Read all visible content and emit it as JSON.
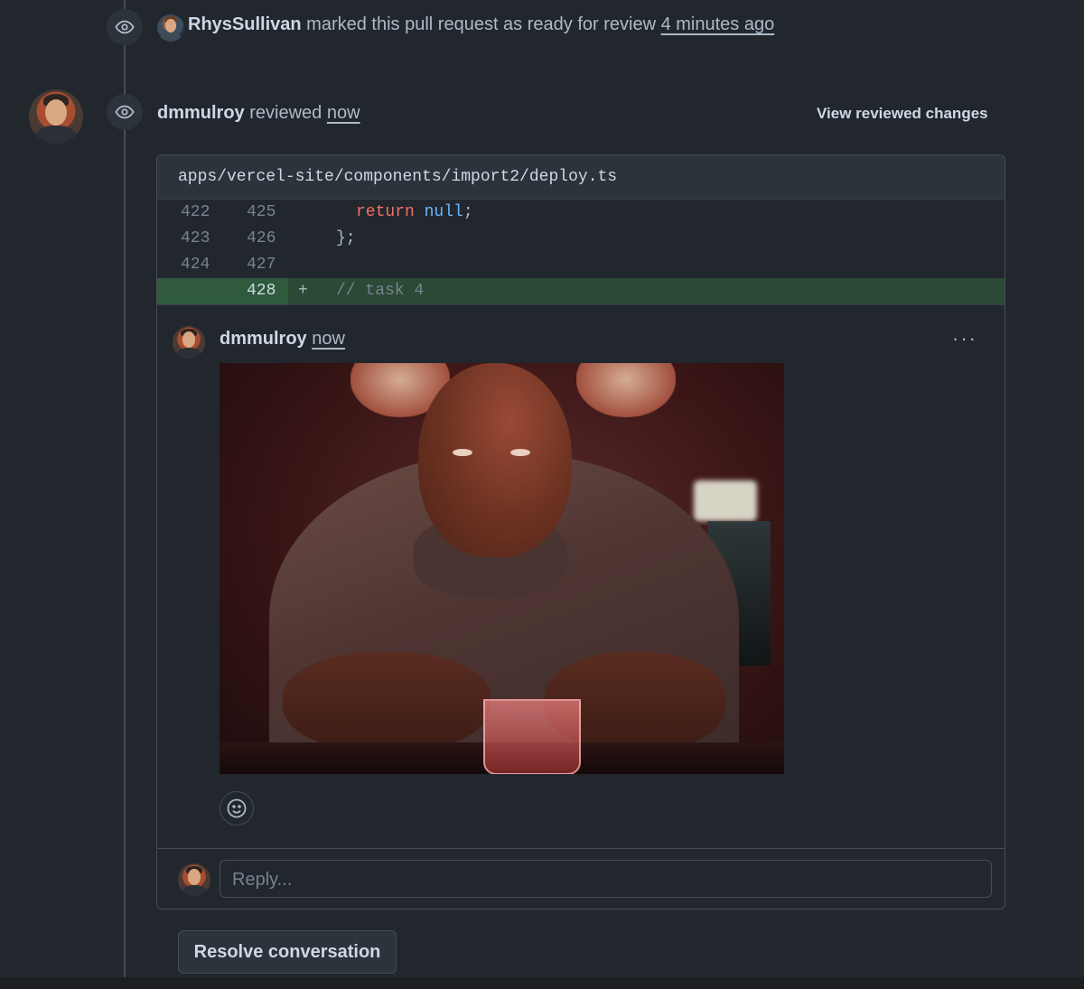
{
  "timeline": {
    "event1": {
      "user": "RhysSullivan",
      "action": "marked this pull request as ready for review",
      "time": "4 minutes ago"
    },
    "review": {
      "user": "dmmulroy",
      "action": "reviewed",
      "time": "now",
      "view_changes_label": "View reviewed changes"
    }
  },
  "thread": {
    "file_path": "apps/vercel-site/components/import2/deploy.ts",
    "diff": [
      {
        "old": "422",
        "new": "425",
        "kw": "return",
        "lit": "null",
        "rest": ";"
      },
      {
        "old": "423",
        "new": "426",
        "text": "};"
      },
      {
        "old": "424",
        "new": "427",
        "text": ""
      },
      {
        "old": "",
        "new": "428",
        "sign": "+",
        "text": "// task 4"
      }
    ],
    "comment": {
      "author": "dmmulroy",
      "time": "now",
      "menu_label": "···"
    },
    "reply_placeholder": "Reply...",
    "resolve_label": "Resolve conversation"
  },
  "icons": {
    "event": "eye-icon",
    "reaction": "smiley-icon",
    "menu": "kebab-horizontal-icon"
  },
  "colors": {
    "background": "#22272e",
    "added_line": "#2b4a35",
    "keyword": "#f47067",
    "literal": "#6cb6ff"
  }
}
